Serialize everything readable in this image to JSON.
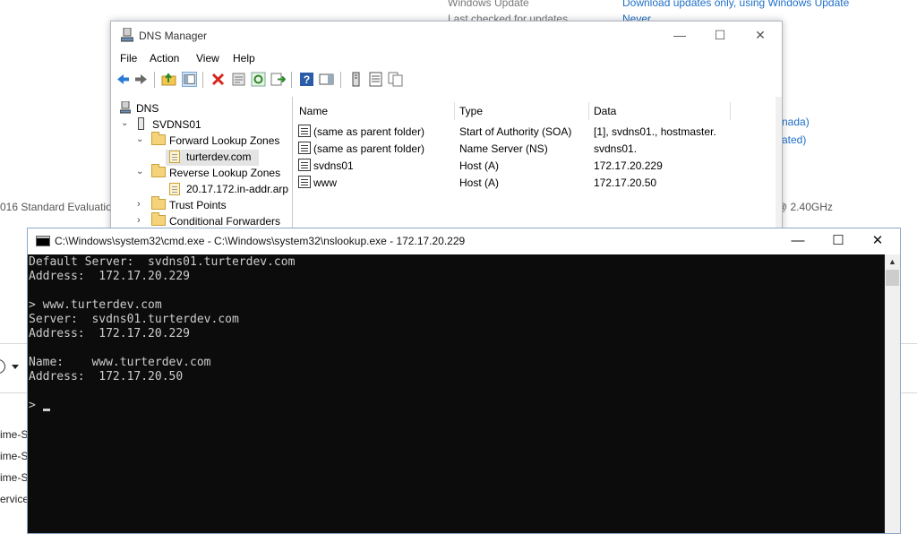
{
  "background": {
    "updates_label": "Windows Update",
    "updates_value": "Download updates only, using Windows Update",
    "last_checked_label": "Last checked for updates",
    "last_checked_value": "Never",
    "region_fragment": "nada)",
    "activation_fragment": "ated)",
    "os_fragment": "016 Standard Evaluation",
    "cpu_fragment": "@ 2.40GHz",
    "list_items": [
      "ime-S",
      "ime-S",
      "ime-S",
      "ervice"
    ]
  },
  "dns_manager": {
    "title": "DNS Manager",
    "menu": [
      "File",
      "Action",
      "View",
      "Help"
    ],
    "tree": {
      "root": "DNS",
      "server": "SVDNS01",
      "forward_zones": "Forward Lookup Zones",
      "forward_zone_item": "turterdev.com",
      "reverse_zones": "Reverse Lookup Zones",
      "reverse_zone_item": "20.17.172.in-addr.arp",
      "trust_points": "Trust Points",
      "conditional_forwarders": "Conditional Forwarders"
    },
    "columns": [
      "Name",
      "Type",
      "Data"
    ],
    "records": [
      {
        "name": "(same as parent folder)",
        "type": "Start of Authority (SOA)",
        "data": "[1], svdns01., hostmaster."
      },
      {
        "name": "(same as parent folder)",
        "type": "Name Server (NS)",
        "data": "svdns01."
      },
      {
        "name": "svdns01",
        "type": "Host (A)",
        "data": "172.17.20.229"
      },
      {
        "name": "www",
        "type": "Host (A)",
        "data": "172.17.20.50"
      }
    ]
  },
  "cmd": {
    "title": "C:\\Windows\\system32\\cmd.exe - C:\\Windows\\system32\\nslookup.exe  - 172.17.20.229",
    "lines": [
      "Default Server:  svdns01.turterdev.com",
      "Address:  172.17.20.229",
      "",
      "> www.turterdev.com",
      "Server:  svdns01.turterdev.com",
      "Address:  172.17.20.229",
      "",
      "Name:    www.turterdev.com",
      "Address:  172.17.20.50",
      "",
      ">"
    ]
  }
}
